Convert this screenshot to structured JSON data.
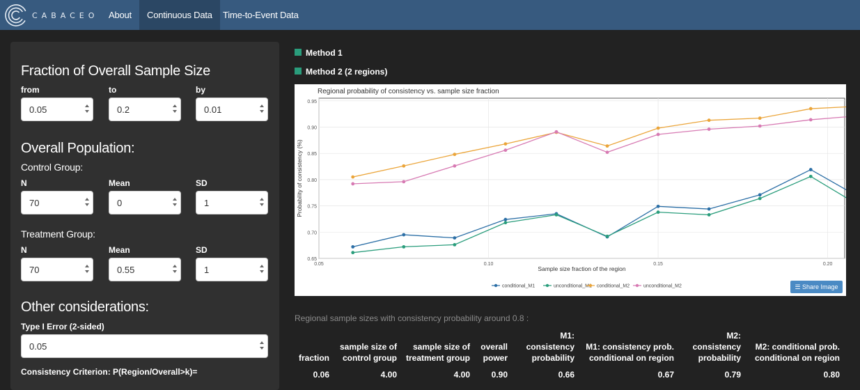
{
  "nav": {
    "brand": "CABACEO",
    "items": [
      {
        "label": "About",
        "active": false
      },
      {
        "label": "Continuous Data",
        "active": true
      },
      {
        "label": "Time-to-Event Data",
        "active": false
      }
    ]
  },
  "sidebar": {
    "fraction": {
      "title": "Fraction of Overall Sample Size",
      "from_label": "from",
      "from_value": "0.05",
      "to_label": "to",
      "to_value": "0.2",
      "by_label": "by",
      "by_value": "0.01"
    },
    "population": {
      "title": "Overall Population:",
      "control": {
        "title": "Control Group:",
        "n_label": "N",
        "n_value": "70",
        "mean_label": "Mean",
        "mean_value": "0",
        "sd_label": "SD",
        "sd_value": "1"
      },
      "treatment": {
        "title": "Treatment Group:",
        "n_label": "N",
        "n_value": "70",
        "mean_label": "Mean",
        "mean_value": "0.55",
        "sd_label": "SD",
        "sd_value": "1"
      }
    },
    "other": {
      "title": "Other considerations:",
      "alpha_label": "Type I Error (2-sided)",
      "alpha_value": "0.05",
      "criterion_label": "Consistency Criterion: P(Region/Overall>k)="
    }
  },
  "methods": {
    "m1": "Method 1",
    "m2": "Method 2 (2 regions)",
    "color": "#2a9d7c"
  },
  "share_label": "Share Image",
  "chart_data": {
    "type": "line",
    "title": "Regional probability of consistency vs. sample size fraction",
    "xlabel": "Sample size fraction of the region",
    "ylabel": "Probability of consistency (%)",
    "xlim": [
      0.05,
      0.205
    ],
    "ylim": [
      0.65,
      0.955
    ],
    "xticks": [
      "0.05",
      "0.10",
      "0.15",
      "0.20"
    ],
    "yticks": [
      "0.65",
      "0.70",
      "0.75",
      "0.80",
      "0.85",
      "0.90",
      "0.95"
    ],
    "grid": true,
    "legend_position": "bottom",
    "x": [
      0.06,
      0.075,
      0.09,
      0.105,
      0.12,
      0.135,
      0.15,
      0.165,
      0.18,
      0.195,
      0.21
    ],
    "series": [
      {
        "name": "conditional_M1",
        "color": "#2c6fa6",
        "values": [
          0.672,
          0.695,
          0.689,
          0.724,
          0.735,
          0.691,
          0.749,
          0.744,
          0.771,
          0.819,
          0.764
        ]
      },
      {
        "name": "unconditional_M1",
        "color": "#2a9d7c",
        "values": [
          0.661,
          0.672,
          0.676,
          0.718,
          0.733,
          0.692,
          0.738,
          0.733,
          0.764,
          0.806,
          0.748
        ]
      },
      {
        "name": "conditional_M2",
        "color": "#eba53a",
        "values": [
          0.805,
          0.826,
          0.848,
          0.868,
          0.89,
          0.864,
          0.898,
          0.913,
          0.917,
          0.935,
          0.94
        ]
      },
      {
        "name": "unconditional_M2",
        "color": "#d77ab3",
        "values": [
          0.792,
          0.796,
          0.826,
          0.856,
          0.891,
          0.852,
          0.886,
          0.896,
          0.902,
          0.914,
          0.922
        ]
      }
    ]
  },
  "table": {
    "title": "Regional sample sizes with consistency probability around 0.8 :",
    "headers": [
      [
        "fraction"
      ],
      [
        "sample size of",
        "control group"
      ],
      [
        "sample size of",
        "treatment group"
      ],
      [
        "overall",
        "power"
      ],
      [
        "M1:",
        "consistency",
        "probability"
      ],
      [
        "M1: consistency prob.",
        "conditional on region"
      ],
      [
        "M2:",
        "consistency",
        "probability"
      ],
      [
        "M2: conditional prob.",
        "conditional on region"
      ]
    ],
    "rows": [
      [
        "0.06",
        "4.00",
        "4.00",
        "0.90",
        "0.66",
        "0.67",
        "0.79",
        "0.80"
      ]
    ]
  }
}
